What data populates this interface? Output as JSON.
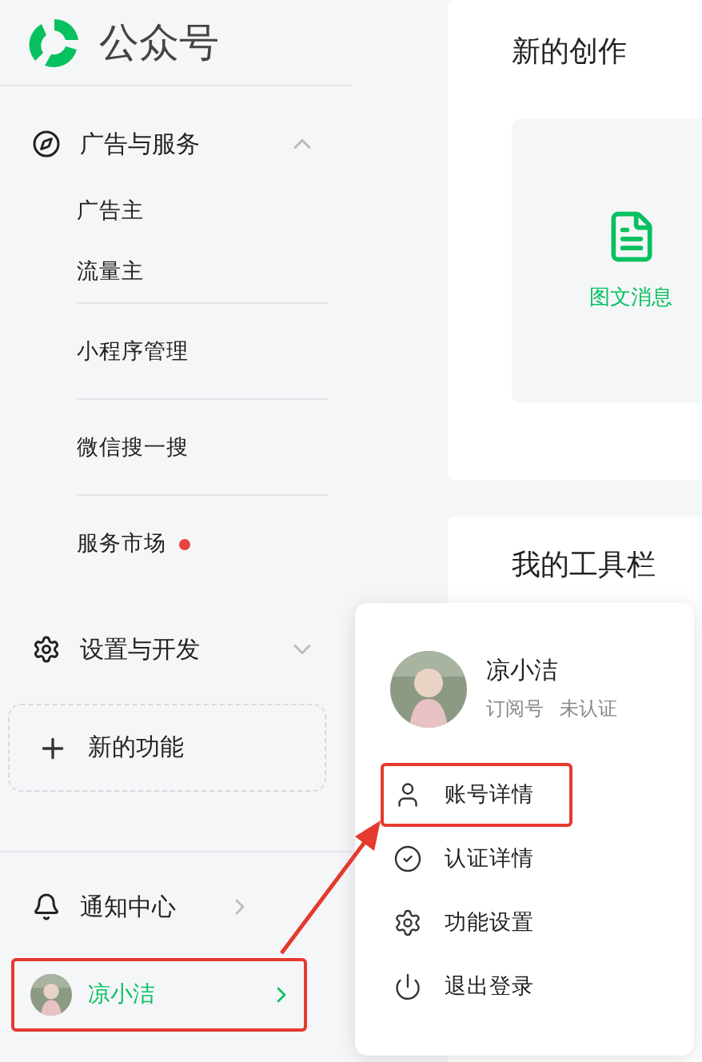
{
  "sidebar": {
    "logo_text": "公众号",
    "groups": [
      {
        "kind": "services",
        "label": "广告与服务",
        "expanded": true,
        "children": [
          {
            "label": "广告主",
            "divider_after": false,
            "dot": false
          },
          {
            "label": "流量主",
            "divider_after": true,
            "dot": false
          },
          {
            "label": "小程序管理",
            "divider_after": true,
            "dot": false
          },
          {
            "label": "微信搜一搜",
            "divider_after": true,
            "dot": false
          },
          {
            "label": "服务市场",
            "divider_after": false,
            "dot": true
          }
        ]
      },
      {
        "kind": "settings",
        "label": "设置与开发",
        "expanded": false
      }
    ],
    "new_feature": {
      "label": "新的功能"
    },
    "notifications": {
      "label": "通知中心"
    },
    "user": {
      "name": "凉小洁",
      "highlighted": true
    }
  },
  "main": {
    "cards": [
      {
        "title": "新的创作",
        "items": [
          {
            "label": "图文消息"
          }
        ]
      },
      {
        "title": "我的工具栏"
      }
    ]
  },
  "popup": {
    "name": "凉小洁",
    "account_type": "订阅号",
    "verification": "未认证",
    "items": [
      {
        "kind": "account",
        "label": "账号详情",
        "highlighted": true
      },
      {
        "kind": "verify",
        "label": "认证详情",
        "highlighted": false
      },
      {
        "kind": "settings",
        "label": "功能设置",
        "highlighted": false
      },
      {
        "kind": "logout",
        "label": "退出登录",
        "highlighted": false
      }
    ]
  }
}
